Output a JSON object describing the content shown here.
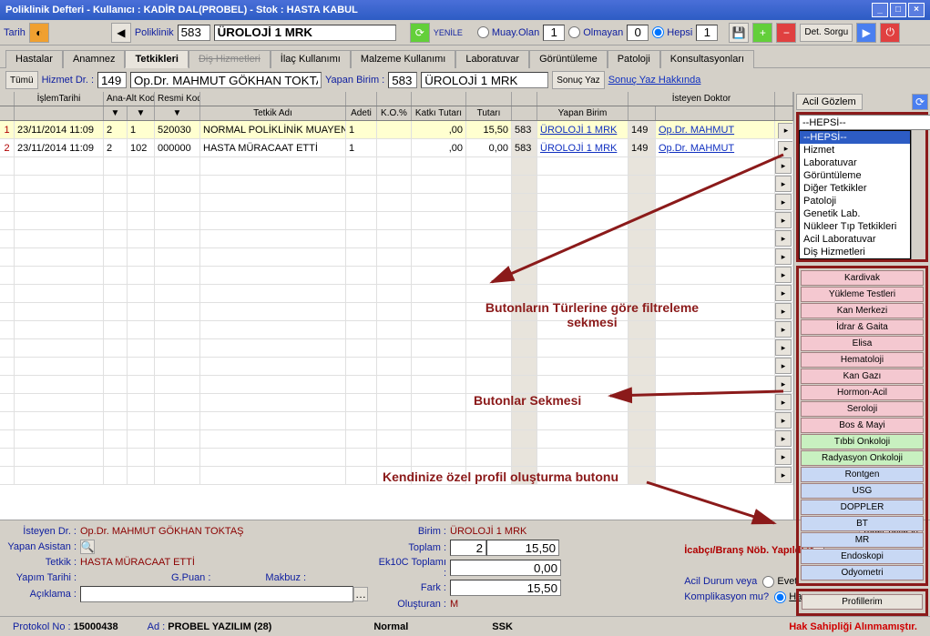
{
  "title": "Poliklinik Defteri - Kullanıcı : KADİR DAL(PROBEL) - Stok : HASTA KABUL",
  "toolbar": {
    "tarih_label": "Tarih",
    "poliklinik_label": "Poliklinik",
    "poliklinik_code": "583",
    "poliklinik_name": "ÜROLOJİ 1 MRK",
    "yenile": "YENİLE",
    "muay_olan": "Muay.Olan",
    "muay_olan_val": "1",
    "olmayan": "Olmayan",
    "olmayan_val": "0",
    "hepsi": "Hepsi",
    "hepsi_val": "1",
    "kaydet": "KAYDET",
    "det_sorgu": "Det. Sorgu",
    "cikis": "ÇIKIŞ"
  },
  "tabs": [
    "Hastalar",
    "Anamnez",
    "Tetkikleri",
    "Diş Hizmetleri",
    "İlaç Kullanımı",
    "Malzeme Kullanımı",
    "Laboratuvar",
    "Görüntüleme",
    "Patoloji",
    "Konsultasyonları"
  ],
  "active_tab": 2,
  "strike_tab": 3,
  "subbar": {
    "tumu": "Tümü",
    "hizmet_dr": "Hizmet Dr. :",
    "hizmet_dr_code": "149",
    "hizmet_dr_name": "Op.Dr. MAHMUT GÖKHAN TOKTAŞ",
    "yapan_birim": "Yapan Birim :",
    "yapan_birim_code": "583",
    "yapan_birim_name": "ÜROLOJİ 1 MRK",
    "sonuc_yaz": "Sonuç Yaz",
    "sonuc_yaz_hakkinda": "Sonuç Yaz Hakkında"
  },
  "grid": {
    "group_headers": {
      "islem_tarihi": "İşlemTarihi",
      "ana_alt_kod": "Ana-Alt Kod",
      "resmi_kod": "Resmi Kod",
      "isteyen_doktor": "İsteyen Doktor"
    },
    "headers": [
      "",
      "",
      "",
      "",
      "",
      "Tetkik Adı",
      "Adeti",
      "K.O.%",
      "Katkı Tutarı",
      "Tutarı",
      "",
      "Yapan Birim",
      "",
      ""
    ],
    "rows": [
      {
        "n": "1",
        "tarih": "23/11/2014 11:09",
        "ana": "2",
        "alt": "1",
        "resmi": "520030",
        "tetkik": "NORMAL POLİKLİNİK MUAYEN",
        "adet": "1",
        "ko": "",
        "katki": ",00",
        "tutar": "15,50",
        "bcode": "583",
        "birim": "ÜROLOJİ 1 MRK",
        "dcode": "149",
        "doktor": "Op.Dr. MAHMUT"
      },
      {
        "n": "2",
        "tarih": "23/11/2014 11:09",
        "ana": "2",
        "alt": "102",
        "resmi": "000000",
        "tetkik": "HASTA MÜRACAAT ETTİ",
        "adet": "1",
        "ko": "",
        "katki": ",00",
        "tutar": "0,00",
        "bcode": "583",
        "birim": "ÜROLOJİ 1 MRK",
        "dcode": "149",
        "doktor": "Op.Dr. MAHMUT"
      }
    ]
  },
  "right": {
    "tab": "Acil Gözlem",
    "dd_value": "--HEPSİ--",
    "dd_items": [
      "--HEPSİ--",
      "Hizmet",
      "Laboratuvar",
      "Görüntüleme",
      "Diğer Tetkikler",
      "Patoloji",
      "Genetik Lab.",
      "Nükleer Tıp Tetkikleri",
      "Acil Laboratuvar",
      "Diş Hizmetleri"
    ],
    "cats_pink": [
      "Kardivak",
      "Yükleme Testleri",
      "Kan Merkezi",
      "İdrar & Gaita",
      "Elisa",
      "Hematoloji",
      "Kan Gazı",
      "Hormon-Acil",
      "Seroloji",
      "Bos & Mayi"
    ],
    "cats_green": [
      "Tıbbi Onkoloji",
      "Radyasyon Onkoloji"
    ],
    "cats_blue": [
      "Rontgen",
      "USG",
      "DOPPLER",
      "BT",
      "MR",
      "Endoskopi",
      "Odyometri"
    ],
    "profillerim": "Profillerim"
  },
  "bottom": {
    "isteyen_dr_label": "İsteyen Dr. :",
    "isteyen_dr": "Op.Dr. MAHMUT GÖKHAN TOKTAŞ",
    "yapan_asistan_label": "Yapan Asistan :",
    "tetkik_label": "Tetkik :",
    "tetkik": "HASTA MÜRACAAT ETTİ",
    "yapim_tarihi_label": "Yapım Tarihi :",
    "gpuan_label": "G.Puan :",
    "makbuz_label": "Makbuz :",
    "aciklama_label": "Açıklama :",
    "birim_label": "Birim :",
    "birim": "ÜROLOJİ 1 MRK",
    "toplam_label": "Toplam :",
    "toplam_count": "2",
    "toplam_val": "15,50",
    "ek10c_label": "Ek10C Toplamı :",
    "ek10c_val": "0,00",
    "fark_label": "Fark :",
    "fark_val": "15,50",
    "olusturan_label": "Oluşturan :",
    "olusturan": "M",
    "icabci_label": "İcabçı/Branş Nöb. Yapıldı ?",
    "acil_label": "Acil Durum veya",
    "komplikasyon_label": "Komplikasyon mu?",
    "evet": "Evet",
    "hayir": "Hayır",
    "bagli_takip": "Bağlı Takip Al"
  },
  "status": {
    "protokol_label": "Protokol No :",
    "protokol": "15000438",
    "ad_label": "Ad :",
    "ad": "PROBEL YAZILIM  (28)",
    "normal": "Normal",
    "ssk": "SSK",
    "hak": "Hak Sahipliği Alınmamıştır."
  },
  "annotations": {
    "a1": "Butonların Türlerine göre filtreleme sekmesi",
    "a2": "Butonlar Sekmesi",
    "a3": "Kendinize özel profil oluşturma butonu"
  }
}
